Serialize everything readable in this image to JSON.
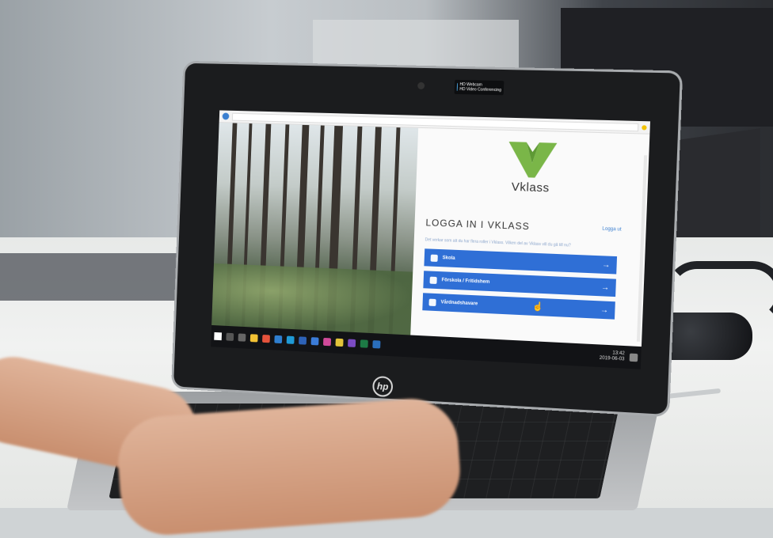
{
  "webcam": {
    "title": "HD Webcam",
    "subtitle": "HD Video Conferencing"
  },
  "brand": {
    "laptop_logo": "hp",
    "app_name": "Vklass",
    "accent_color": "#7ab648",
    "button_color": "#2f6fd6"
  },
  "login": {
    "title": "LOGGA IN I VKLASS",
    "link": "Logga ut",
    "subtitle": "Det verkar som att du har flera roller i Vklass. Vilken del av Vklass vill du gå till nu?",
    "roles": [
      {
        "label": "Skola",
        "icon": "school-icon"
      },
      {
        "label": "Förskola / Fritidshem",
        "icon": "preschool-icon"
      },
      {
        "label": "Vårdnadshavare",
        "icon": "guardian-icon"
      }
    ]
  },
  "taskbar": {
    "time": "13:42",
    "date": "2019-06-03"
  }
}
